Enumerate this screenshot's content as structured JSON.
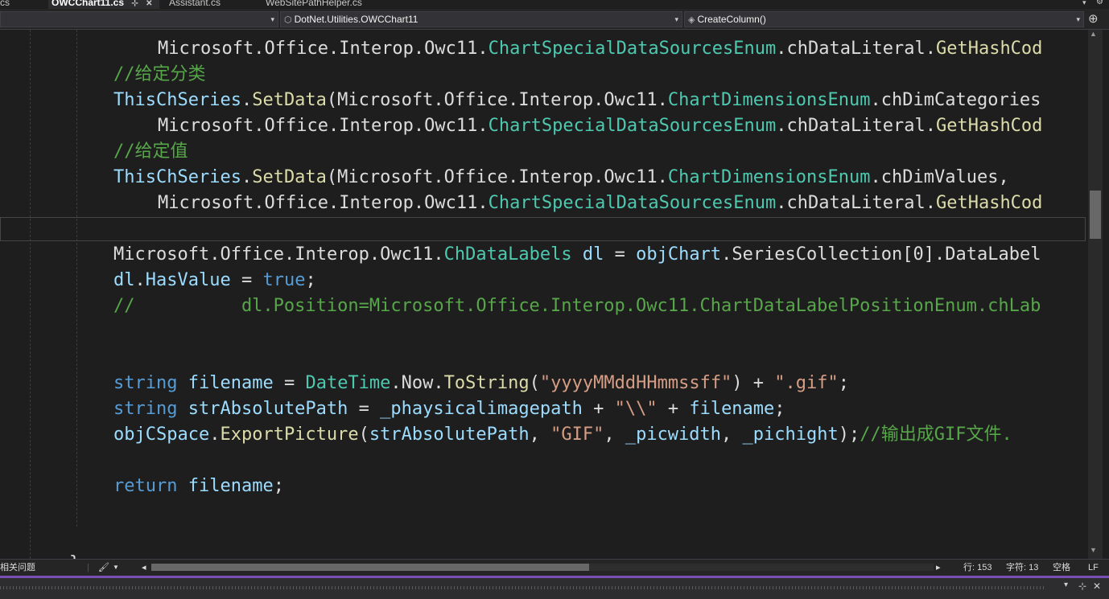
{
  "tabs": [
    {
      "label": "cs",
      "active": false
    },
    {
      "label": "OWCChart11.cs",
      "active": true
    },
    {
      "label": "Assistant.cs",
      "active": false
    },
    {
      "label": "WebSitePathHelper.cs",
      "active": false
    }
  ],
  "tab_icons": {
    "pin": "⊹",
    "close": "✕"
  },
  "nav": {
    "project_dropdown_arrow": "▾",
    "class_combo": "DotNet.Utilities.OWCChart11",
    "member_combo": "CreateColumn()"
  },
  "code_lines": [
    [
      [
        "Microsoft",
        "pl"
      ],
      [
        ".",
        "pl"
      ],
      [
        "Office",
        "pl"
      ],
      [
        ".",
        "pl"
      ],
      [
        "Interop",
        "pl"
      ],
      [
        ".",
        "pl"
      ],
      [
        "Owc11",
        "pl"
      ],
      [
        ".",
        "pl"
      ],
      [
        "ChartSpecialDataSourcesEnum",
        "ty"
      ],
      [
        ".",
        "pl"
      ],
      [
        "chDataLiteral",
        "pl"
      ],
      [
        ".",
        "pl"
      ],
      [
        "GetHashCod",
        "fn"
      ]
    ],
    [
      [
        "//给定分类",
        "cm"
      ]
    ],
    [
      [
        "ThisChSeries",
        "id"
      ],
      [
        ".",
        "pl"
      ],
      [
        "SetData",
        "fn"
      ],
      [
        "(",
        "pl"
      ],
      [
        "Microsoft",
        "pl"
      ],
      [
        ".",
        "pl"
      ],
      [
        "Office",
        "pl"
      ],
      [
        ".",
        "pl"
      ],
      [
        "Interop",
        "pl"
      ],
      [
        ".",
        "pl"
      ],
      [
        "Owc11",
        "pl"
      ],
      [
        ".",
        "pl"
      ],
      [
        "ChartDimensionsEnum",
        "ty"
      ],
      [
        ".",
        "pl"
      ],
      [
        "chDimCategories",
        "pl"
      ]
    ],
    [
      [
        "Microsoft",
        "pl"
      ],
      [
        ".",
        "pl"
      ],
      [
        "Office",
        "pl"
      ],
      [
        ".",
        "pl"
      ],
      [
        "Interop",
        "pl"
      ],
      [
        ".",
        "pl"
      ],
      [
        "Owc11",
        "pl"
      ],
      [
        ".",
        "pl"
      ],
      [
        "ChartSpecialDataSourcesEnum",
        "ty"
      ],
      [
        ".",
        "pl"
      ],
      [
        "chDataLiteral",
        "pl"
      ],
      [
        ".",
        "pl"
      ],
      [
        "GetHashCod",
        "fn"
      ]
    ],
    [
      [
        "//给定值",
        "cm"
      ]
    ],
    [
      [
        "ThisChSeries",
        "id"
      ],
      [
        ".",
        "pl"
      ],
      [
        "SetData",
        "fn"
      ],
      [
        "(",
        "pl"
      ],
      [
        "Microsoft",
        "pl"
      ],
      [
        ".",
        "pl"
      ],
      [
        "Office",
        "pl"
      ],
      [
        ".",
        "pl"
      ],
      [
        "Interop",
        "pl"
      ],
      [
        ".",
        "pl"
      ],
      [
        "Owc11",
        "pl"
      ],
      [
        ".",
        "pl"
      ],
      [
        "ChartDimensionsEnum",
        "ty"
      ],
      [
        ".",
        "pl"
      ],
      [
        "chDimValues,",
        "pl"
      ]
    ],
    [
      [
        "Microsoft",
        "pl"
      ],
      [
        ".",
        "pl"
      ],
      [
        "Office",
        "pl"
      ],
      [
        ".",
        "pl"
      ],
      [
        "Interop",
        "pl"
      ],
      [
        ".",
        "pl"
      ],
      [
        "Owc11",
        "pl"
      ],
      [
        ".",
        "pl"
      ],
      [
        "ChartSpecialDataSourcesEnum",
        "ty"
      ],
      [
        ".",
        "pl"
      ],
      [
        "chDataLiteral",
        "pl"
      ],
      [
        ".",
        "pl"
      ],
      [
        "GetHashCod",
        "fn"
      ]
    ],
    [],
    [
      [
        "Microsoft",
        "pl"
      ],
      [
        ".",
        "pl"
      ],
      [
        "Office",
        "pl"
      ],
      [
        ".",
        "pl"
      ],
      [
        "Interop",
        "pl"
      ],
      [
        ".",
        "pl"
      ],
      [
        "Owc11",
        "pl"
      ],
      [
        ".",
        "pl"
      ],
      [
        "ChDataLabels",
        "ty"
      ],
      [
        " ",
        "pl"
      ],
      [
        "dl",
        "id"
      ],
      [
        " = ",
        "pl"
      ],
      [
        "objChart",
        "id"
      ],
      [
        ".",
        "pl"
      ],
      [
        "SeriesCollection",
        "pl"
      ],
      [
        "[0].",
        "pl"
      ],
      [
        "DataLabel",
        "pl"
      ]
    ],
    [
      [
        "dl",
        "id"
      ],
      [
        ".",
        "pl"
      ],
      [
        "HasValue",
        "id"
      ],
      [
        " = ",
        "pl"
      ],
      [
        "true",
        "kw"
      ],
      [
        ";",
        "pl"
      ]
    ],
    [
      [
        "//          dl.Position=Microsoft.Office.Interop.Owc11.ChartDataLabelPositionEnum.chLab",
        "cm"
      ]
    ],
    [],
    [],
    [
      [
        "string",
        "kw"
      ],
      [
        " ",
        "pl"
      ],
      [
        "filename",
        "id"
      ],
      [
        " = ",
        "pl"
      ],
      [
        "DateTime",
        "ty"
      ],
      [
        ".",
        "pl"
      ],
      [
        "Now",
        "pl"
      ],
      [
        ".",
        "pl"
      ],
      [
        "ToString",
        "fn"
      ],
      [
        "(",
        "pl"
      ],
      [
        "\"yyyyMMddHHmmssff\"",
        "st"
      ],
      [
        ") + ",
        "pl"
      ],
      [
        "\".gif\"",
        "st"
      ],
      [
        ";",
        "pl"
      ]
    ],
    [
      [
        "string",
        "kw"
      ],
      [
        " ",
        "pl"
      ],
      [
        "strAbsolutePath",
        "id"
      ],
      [
        " = ",
        "pl"
      ],
      [
        "_phaysicalimagepath",
        "id"
      ],
      [
        " + ",
        "pl"
      ],
      [
        "\"\\\\\"",
        "st"
      ],
      [
        " + ",
        "pl"
      ],
      [
        "filename",
        "id"
      ],
      [
        ";",
        "pl"
      ]
    ],
    [
      [
        "objCSpace",
        "id"
      ],
      [
        ".",
        "pl"
      ],
      [
        "ExportPicture",
        "fn"
      ],
      [
        "(",
        "pl"
      ],
      [
        "strAbsolutePath",
        "id"
      ],
      [
        ", ",
        "pl"
      ],
      [
        "\"GIF\"",
        "st"
      ],
      [
        ", ",
        "pl"
      ],
      [
        "_picwidth",
        "id"
      ],
      [
        ", ",
        "pl"
      ],
      [
        "_pichight",
        "id"
      ],
      [
        ");",
        "pl"
      ],
      [
        "//输出成GIF文件.",
        "cm"
      ]
    ],
    [],
    [
      [
        "return",
        "kw"
      ],
      [
        " ",
        "pl"
      ],
      [
        "filename",
        "id"
      ],
      [
        ";",
        "pl"
      ]
    ],
    [],
    [],
    [
      [
        "}",
        "pl"
      ]
    ]
  ],
  "status": {
    "problems": "相关问题",
    "line": "行: 153",
    "char": "字符: 13",
    "spaces": "空格",
    "eol": "LF",
    "brush_icon": "🖌",
    "arrow_left": "◂",
    "arrow_right": "▸"
  },
  "scroll_position_fraction": 0.31,
  "colors": {
    "accent": "#7a4fb5"
  }
}
